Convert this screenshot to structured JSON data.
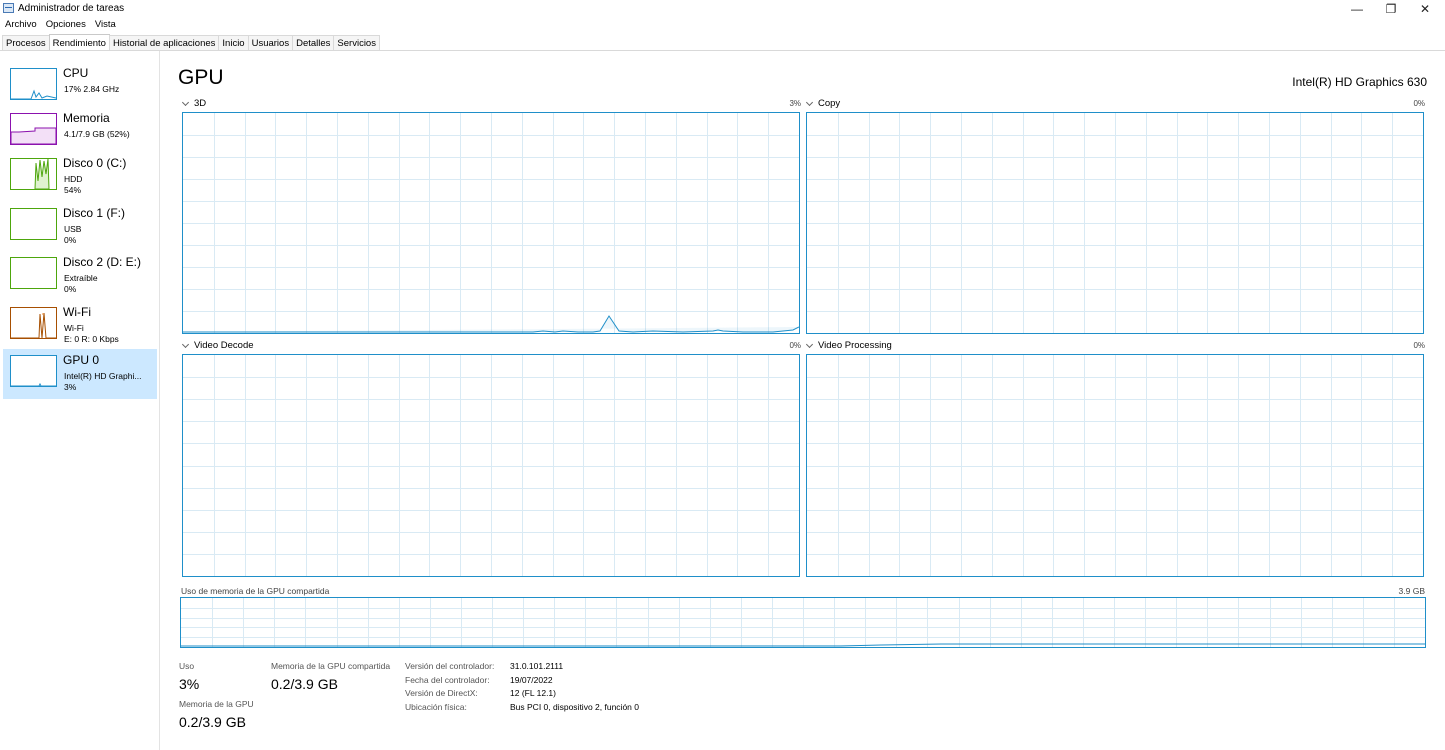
{
  "window": {
    "title": "Administrador de tareas",
    "minimize_glyph": "—",
    "restore_glyph": "❐",
    "close_glyph": "✕"
  },
  "menu": [
    "Archivo",
    "Opciones",
    "Vista"
  ],
  "tabs": [
    "Procesos",
    "Rendimiento",
    "Historial de aplicaciones",
    "Inicio",
    "Usuarios",
    "Detalles",
    "Servicios"
  ],
  "active_tab": "Rendimiento",
  "sidebar": [
    {
      "name": "CPU",
      "sub1": "17%  2.84 GHz",
      "sub2": "",
      "color": "#1f8fc9"
    },
    {
      "name": "Memoria",
      "sub1": "4.1/7.9 GB (52%)",
      "sub2": "",
      "color": "#8b12ae"
    },
    {
      "name": "Disco 0 (C:)",
      "sub1": "HDD",
      "sub2": "54%",
      "color": "#4da60c"
    },
    {
      "name": "Disco 1 (F:)",
      "sub1": "USB",
      "sub2": "0%",
      "color": "#4da60c"
    },
    {
      "name": "Disco 2 (D: E:)",
      "sub1": "Extraíble",
      "sub2": "0%",
      "color": "#4da60c"
    },
    {
      "name": "Wi-Fi",
      "sub1": "Wi-Fi",
      "sub2": "E: 0 R: 0 Kbps",
      "color": "#a74f01"
    },
    {
      "name": "GPU 0",
      "sub1": "Intel(R) HD Graphi...",
      "sub2": "3%",
      "color": "#1f8fc9"
    }
  ],
  "main": {
    "title": "GPU",
    "device": "Intel(R) HD Graphics 630",
    "engines": [
      {
        "label": "3D",
        "pct": "3%"
      },
      {
        "label": "Copy",
        "pct": "0%"
      },
      {
        "label": "Video Decode",
        "pct": "0%"
      },
      {
        "label": "Video Processing",
        "pct": "0%"
      }
    ],
    "shared_memory_label": "Uso de memoria de la GPU compartida",
    "shared_memory_max": "3.9 GB"
  },
  "stats": {
    "uso_label": "Uso",
    "uso_value": "3%",
    "shared_label": "Memoria de la GPU compartida",
    "shared_value": "0.2/3.9 GB",
    "gpu_mem_label": "Memoria de la GPU",
    "gpu_mem_value": "0.2/3.9 GB"
  },
  "info": [
    {
      "label": "Versión del controlador:",
      "value": "31.0.101.2111"
    },
    {
      "label": "Fecha del controlador:",
      "value": "19/07/2022"
    },
    {
      "label": "Versión de DirectX:",
      "value": "12 (FL 12.1)"
    },
    {
      "label": "Ubicación física:",
      "value": "Bus PCI 0, dispositivo 2, función 0"
    }
  ],
  "colors": {
    "graph_line": "#1f8fc9",
    "grid": "#d9eaf4",
    "selected": "#cce8ff"
  }
}
